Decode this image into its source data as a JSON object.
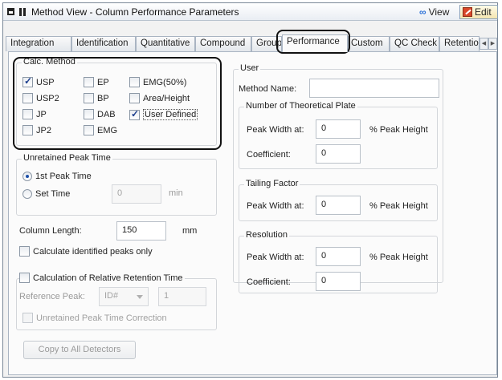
{
  "window": {
    "title": "Method View - Column Performance Parameters",
    "view_label": "View",
    "edit_label": "Edit"
  },
  "tabs": [
    {
      "label": "Integration"
    },
    {
      "label": "Identification"
    },
    {
      "label": "Quantitative"
    },
    {
      "label": "Compound"
    },
    {
      "label": "Group"
    },
    {
      "label": "Performance",
      "active": true
    },
    {
      "label": "Custom"
    },
    {
      "label": "QC Check"
    },
    {
      "label": "Retention"
    }
  ],
  "calc_method": {
    "title": "Calc. Method",
    "options": [
      {
        "label": "USP",
        "checked": true
      },
      {
        "label": "USP2",
        "checked": false
      },
      {
        "label": "JP",
        "checked": false
      },
      {
        "label": "JP2",
        "checked": false
      },
      {
        "label": "EP",
        "checked": false
      },
      {
        "label": "BP",
        "checked": false
      },
      {
        "label": "DAB",
        "checked": false
      },
      {
        "label": "EMG",
        "checked": false
      },
      {
        "label": "EMG(50%)",
        "checked": false
      },
      {
        "label": "Area/Height",
        "checked": false
      },
      {
        "label": "User Defined",
        "checked": true
      }
    ]
  },
  "unretained_peak": {
    "title": "Unretained Peak Time",
    "option_1": "1st Peak Time",
    "option_2": "Set Time",
    "selected": "1st Peak Time",
    "set_time_value": "0",
    "set_time_unit": "min"
  },
  "column_length": {
    "label": "Column Length:",
    "value": "150",
    "unit": "mm"
  },
  "calc_identified": {
    "label": "Calculate identified peaks only",
    "checked": false
  },
  "relative_retention": {
    "title": "Calculation of Relative Retention Time",
    "checked": false,
    "reference_peak_label": "Reference Peak:",
    "reference_peak_select": "ID#",
    "reference_peak_value": "1",
    "unretained_correction": "Unretained Peak Time Correction"
  },
  "copy_button": "Copy to All Detectors",
  "user": {
    "title": "User",
    "method_name_label": "Method Name:",
    "method_name_value": "",
    "theoretical_plate": {
      "title": "Number of Theoretical Plate",
      "peak_width_label": "Peak Width at:",
      "peak_width_value": "0",
      "peak_width_unit": "% Peak Height",
      "coefficient_label": "Coefficient:",
      "coefficient_value": "0"
    },
    "tailing_factor": {
      "title": "Tailing Factor",
      "peak_width_label": "Peak Width at:",
      "peak_width_value": "0",
      "peak_width_unit": "% Peak Height"
    },
    "resolution": {
      "title": "Resolution",
      "peak_width_label": "Peak Width at:",
      "peak_width_value": "0",
      "peak_width_unit": "% Peak Height",
      "coefficient_label": "Coefficient:",
      "coefficient_value": "0"
    }
  }
}
